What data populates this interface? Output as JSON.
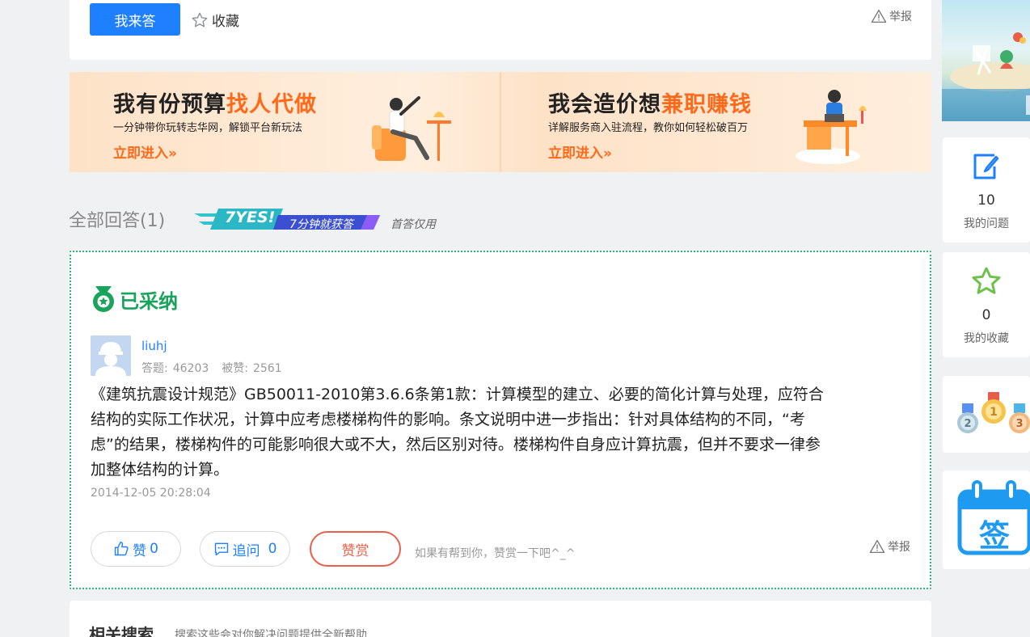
{
  "top": {
    "answer_btn": "我来答",
    "favorite": "收藏",
    "report": "举报"
  },
  "banner": {
    "left": {
      "title_plain": "我有份预算",
      "title_highlight": "找人代做",
      "subtitle": "一分钟带你玩转志华网，解锁平台新玩法",
      "cta": "立即进入»"
    },
    "right": {
      "title_plain": "我会造价想",
      "title_highlight": "兼职赚钱",
      "subtitle": "详解服务商入驻流程，教你如何轻松破百万",
      "cta": "立即进入»"
    }
  },
  "answers_header": {
    "title": "全部回答(1)",
    "badge_yes": "7YES!",
    "badge_text": "7分钟就获答",
    "first_only": "首答仅用"
  },
  "answer": {
    "adopted": "已采纳",
    "username": "liuhj",
    "stats_answers_label": "答题:",
    "stats_answers": "46203",
    "stats_liked_label": "被赞:",
    "stats_liked": "2561",
    "text": "《建筑抗震设计规范》GB50011-2010第3.6.6条第1款：计算模型的建立、必要的简化计算与处理，应符合结构的实际工作状况，计算中应考虑楼梯构件的影响。条文说明中进一步指出：针对具体结构的不同，“考虑”的结果，楼梯构件的可能影响很大或不大，然后区别对待。楼梯构件自身应计算抗震，但并不要求一律参加整体结构的计算。",
    "date": "2014-12-05 20:28:04",
    "like_label": "赞",
    "like_count": "0",
    "followup_label": "追问",
    "followup_count": "0",
    "reward_label": "赞赏",
    "reward_hint": "如果有帮到你，赞赏一下吧^_^",
    "report": "举报"
  },
  "related": {
    "title": "相关搜索",
    "subtitle": "搜索这些会对你解决问题提供全新帮助"
  },
  "sidebar": {
    "my_questions_count": "10",
    "my_questions_label": "我的问题",
    "my_favs_count": "0",
    "my_favs_label": "我的收藏",
    "signin_label": "签"
  },
  "colors": {
    "primary": "#1e80ff",
    "adopted_green": "#1aa35c",
    "highlight_orange": "#ff6a1a",
    "reward_red": "#e9604a"
  }
}
